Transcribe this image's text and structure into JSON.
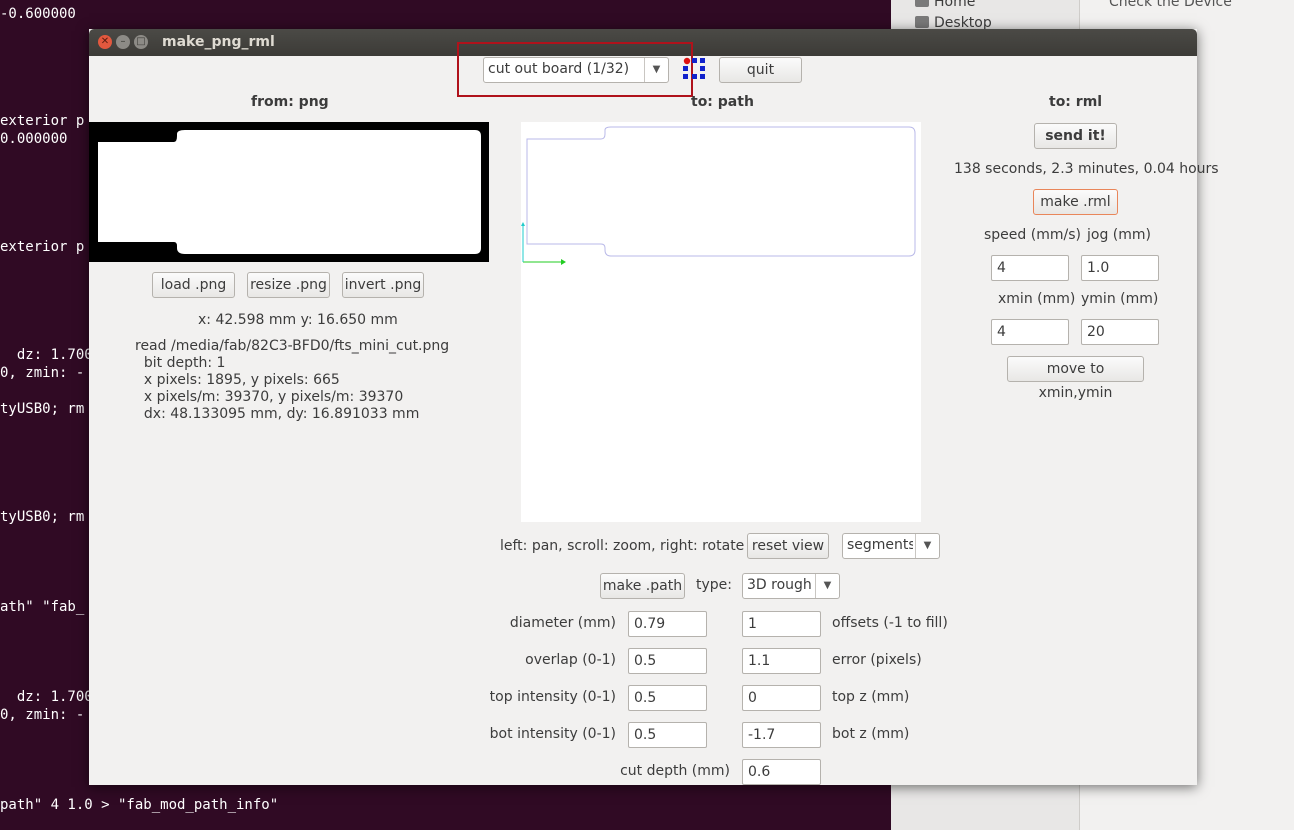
{
  "terminal": {
    "lines": [
      "-0.600000",
      "exterior p",
      "0.000000",
      "exterior p",
      "  dz: 1.700",
      "0, zmin: -",
      "tyUSB0; rm",
      "tyUSB0; rm",
      "ath\" \"fab_",
      "  dz: 1.700",
      "0, zmin: -",
      "path\" 4 1.0 > \"fab_mod_path_info\""
    ]
  },
  "file_manager": {
    "places": [
      "Home",
      "Desktop"
    ],
    "main_text": "Check the Device"
  },
  "window": {
    "title": "make_png_rml"
  },
  "toolbar": {
    "process_select": "cut out board (1/32)",
    "quit_label": "quit",
    "fab_icon": "fab-logo-icon"
  },
  "png_panel": {
    "header": "from: png",
    "load_label": "load .png",
    "resize_label": "resize .png",
    "invert_label": "invert .png",
    "coords": "x: 42.598 mm  y: 16.650 mm",
    "info": [
      "read /media/fab/82C3-BFD0/fts_mini_cut.png",
      "  bit depth: 1",
      "  x pixels: 1895, y pixels: 665",
      "  x pixels/m: 39370, y pixels/m: 39370",
      "  dx: 48.133095 mm, dy: 16.891033 mm"
    ]
  },
  "path_panel": {
    "header": "to: path",
    "view_help": "left: pan, scroll: zoom, right: rotate",
    "reset_label": "reset view",
    "display_select": "segments",
    "make_path_label": "make .path",
    "type_label": "type:",
    "type_select": "3D rough",
    "params": {
      "diameter_label": "diameter (mm)",
      "diameter": "0.79",
      "offsets": "1",
      "offsets_label": "offsets (-1 to fill)",
      "overlap_label": "overlap (0-1)",
      "overlap": "0.5",
      "error": "1.1",
      "error_label": "error (pixels)",
      "top_intensity_label": "top intensity (0-1)",
      "top_intensity": "0.5",
      "top_z": "0",
      "top_z_label": "top z (mm)",
      "bot_intensity_label": "bot intensity (0-1)",
      "bot_intensity": "0.5",
      "bot_z": "-1.7",
      "bot_z_label": "bot z (mm)",
      "cut_depth_label": "cut depth (mm)",
      "cut_depth": "0.6"
    }
  },
  "rml_panel": {
    "header": "to: rml",
    "send_label": "send it!",
    "time_estimate": "138 seconds, 2.3 minutes, 0.04 hours",
    "make_rml_label": "make .rml",
    "speed_label": "speed (mm/s)",
    "jog_label": "jog (mm)",
    "speed": "4",
    "jog": "1.0",
    "xmin_label": "xmin (mm)",
    "ymin_label": "ymin (mm)",
    "xmin": "4",
    "ymin": "20",
    "move_label": "move to xmin,ymin"
  },
  "colors": {
    "highlight": "#b0121b",
    "path_outline": "#b8b8e8",
    "axis_x": "#22cc22",
    "axis_y": "#22cccc"
  }
}
